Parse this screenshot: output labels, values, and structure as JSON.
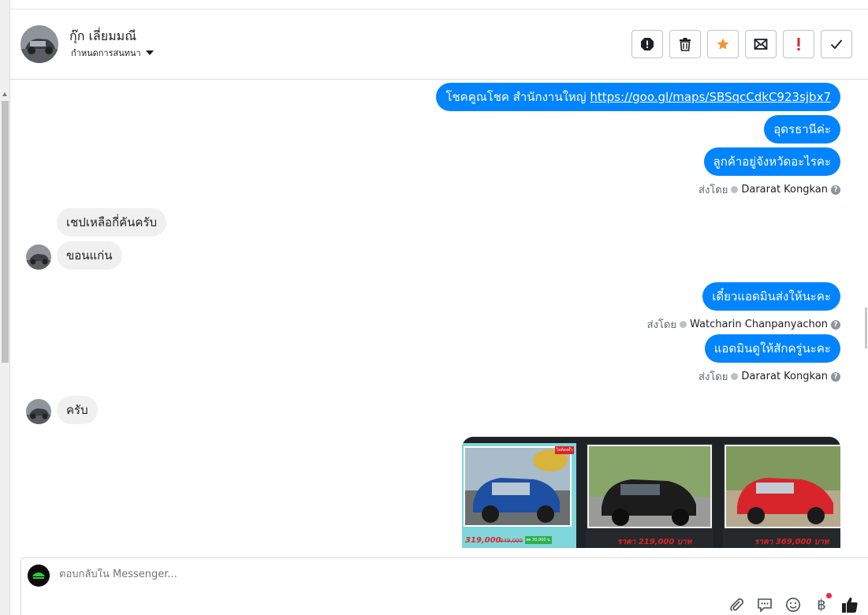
{
  "header": {
    "contact_name": "กุ๊ก เลี่ยมมณี",
    "conversation_label": "กำหนดการสนทนา",
    "actions": [
      "spam-icon",
      "trash-icon",
      "star-icon",
      "mark-unread-icon",
      "important-icon",
      "done-icon"
    ]
  },
  "messages": {
    "out1_text": "โชคคูณโชค สำนักงานใหญ่ ",
    "out1_link": "https://goo.gl/maps/SBSqcCdkC923sjbx7",
    "out2": "อุดรธานีค่ะ",
    "out3": "ลูกค้าอยู่จังหวัดอะไรคะ",
    "sent_by_label": "ส่งโดย",
    "agent1": "Dararat Kongkan",
    "in1": "เชปเหลือกี่คันครับ",
    "in2": "ขอนแก่น",
    "out4": "เดี๋ยวแอดมินส่งให้นะคะ",
    "agent2": "Watcharin Chanpanyachon",
    "out5": "แอดมินดูให้สักครู่นะคะ",
    "agent3": "Dararat Kongkan",
    "in3": "ครับ"
  },
  "image_card": {
    "tile1_price": "319,000",
    "tile1_old": "349,000",
    "tile1_badge": "ลด 30,000 บ.",
    "tile1_corner": "ไม่ต้องค้ำ",
    "tile2_price": "ราคา 219,000 บาท",
    "tile3_price": "ราคา 369,000 บาท"
  },
  "composer": {
    "placeholder": "ตอบกลับใน Messenger...",
    "icons": [
      "paperclip-icon",
      "saved-reply-icon",
      "emoji-icon",
      "baht-payment-icon",
      "thumbs-up-icon"
    ],
    "baht_symbol": "฿"
  },
  "colors": {
    "outgoing_bubble": "#0084ff",
    "incoming_bubble": "#f0f0f0",
    "star": "#f7923a",
    "important": "#e02424"
  }
}
